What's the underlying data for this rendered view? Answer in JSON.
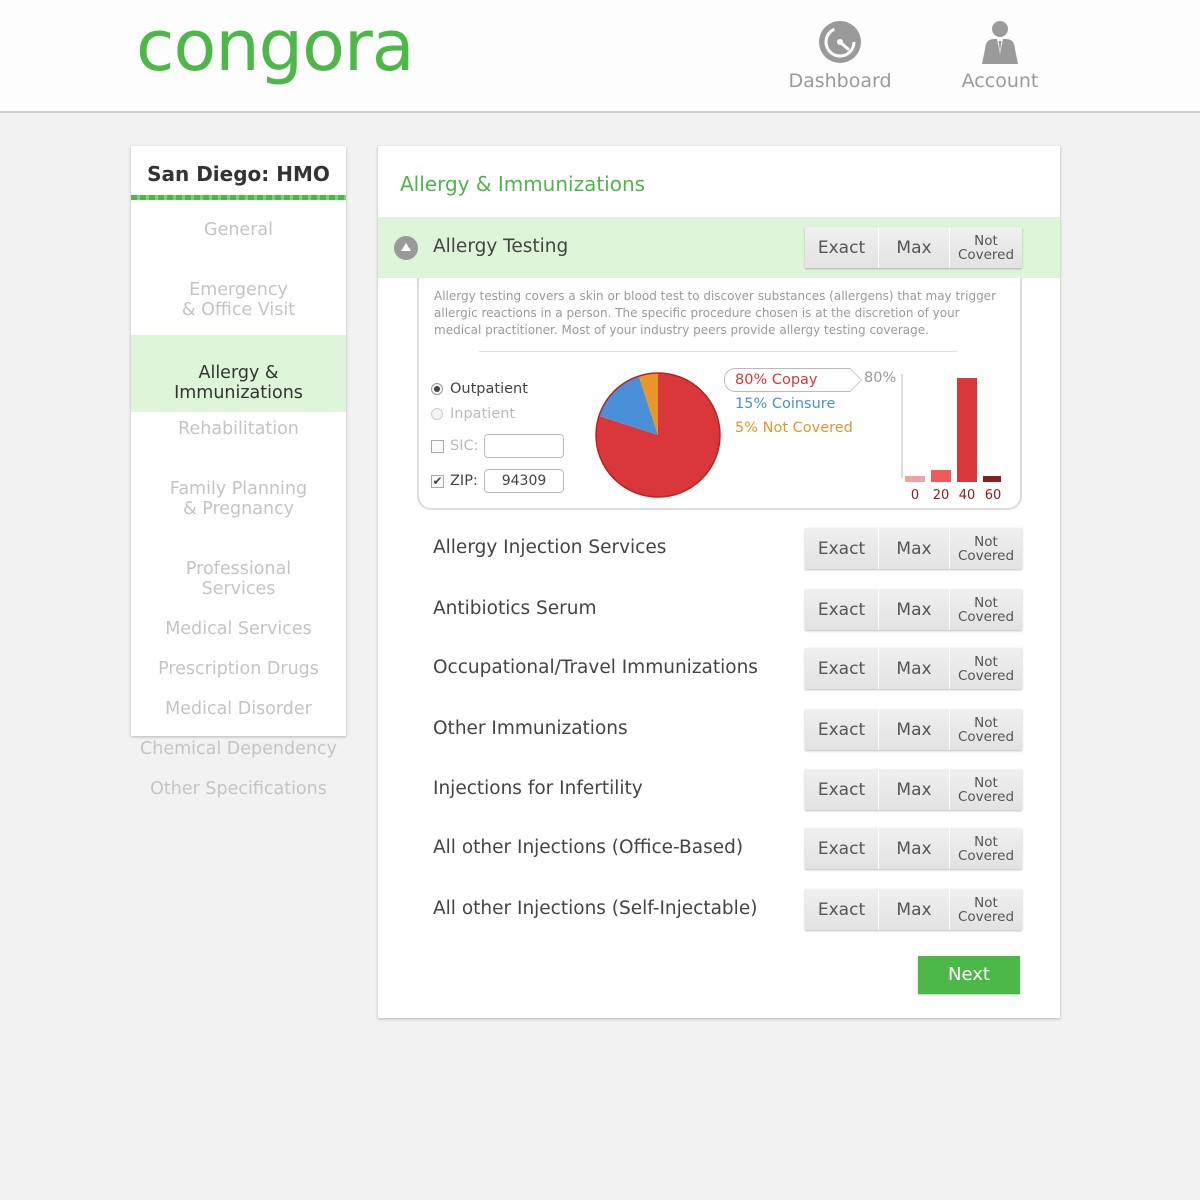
{
  "header": {
    "logo_text": "congora",
    "nav": [
      {
        "label": "Dashboard",
        "icon": "dashboard-gauge-icon"
      },
      {
        "label": "Account",
        "icon": "account-person-icon"
      }
    ]
  },
  "sidebar": {
    "title": "San Diego: HMO",
    "items": [
      {
        "label": "General"
      },
      {
        "label": "Emergency\n& Office Visit"
      },
      {
        "label": "Allergy &\nImmunizations",
        "active": true
      },
      {
        "label": "Rehabilitation"
      },
      {
        "label": "Family Planning\n& Pregnancy"
      },
      {
        "label": "Professional\nServices"
      },
      {
        "label": "Medical Services"
      },
      {
        "label": "Prescription Drugs"
      },
      {
        "label": "Medical Disorder"
      },
      {
        "label": "Chemical Dependency"
      },
      {
        "label": "Other Specifications"
      }
    ]
  },
  "main": {
    "title": "Allergy & Immunizations",
    "buttons": {
      "exact": "Exact",
      "max": "Max",
      "not_covered": "Not Covered"
    },
    "expanded": {
      "label": "Allergy Testing",
      "description": "Allergy testing covers a skin or blood test to discover substances (allergens) that may trigger allergic reactions in a person. The specific procedure chosen is at the discretion of your medical practitioner. Most of your industry peers provide allergy testing coverage.",
      "options": {
        "outpatient": "Outpatient",
        "inpatient": "Inpatient",
        "sic_label": "SIC:",
        "sic_value": "",
        "zip_label": "ZIP:",
        "zip_value": "94309",
        "selected": "outpatient",
        "zip_checked": true,
        "sic_checked": false
      },
      "legend": {
        "copay": "80% Copay",
        "coinsure": "15% Coinsure",
        "not_covered": "5% Not Covered",
        "highlight_pct": "80%"
      }
    },
    "rows": [
      {
        "label": "Allergy Injection Services"
      },
      {
        "label": "Antibiotics Serum"
      },
      {
        "label": "Occupational/Travel Immunizations"
      },
      {
        "label": "Other Immunizations"
      },
      {
        "label": "Injections for Infertility"
      },
      {
        "label": "All other Injections (Office-Based)"
      },
      {
        "label": "All other Injections (Self-Injectable)"
      }
    ],
    "next_label": "Next"
  },
  "colors": {
    "brand_green": "#4cb847",
    "active_bg": "#dff5d9",
    "copay_red": "#d9373a",
    "coinsure_blue": "#4a90d9",
    "not_covered_orange": "#e8962c"
  },
  "chart_data": [
    {
      "type": "pie",
      "categories": [
        "Copay",
        "Coinsure",
        "Not Covered"
      ],
      "values": [
        80,
        15,
        5
      ]
    },
    {
      "type": "bar",
      "categories": [
        "0",
        "20",
        "40",
        "60"
      ],
      "values": [
        6,
        12,
        100,
        6
      ],
      "ylim": [
        0,
        100
      ]
    }
  ]
}
